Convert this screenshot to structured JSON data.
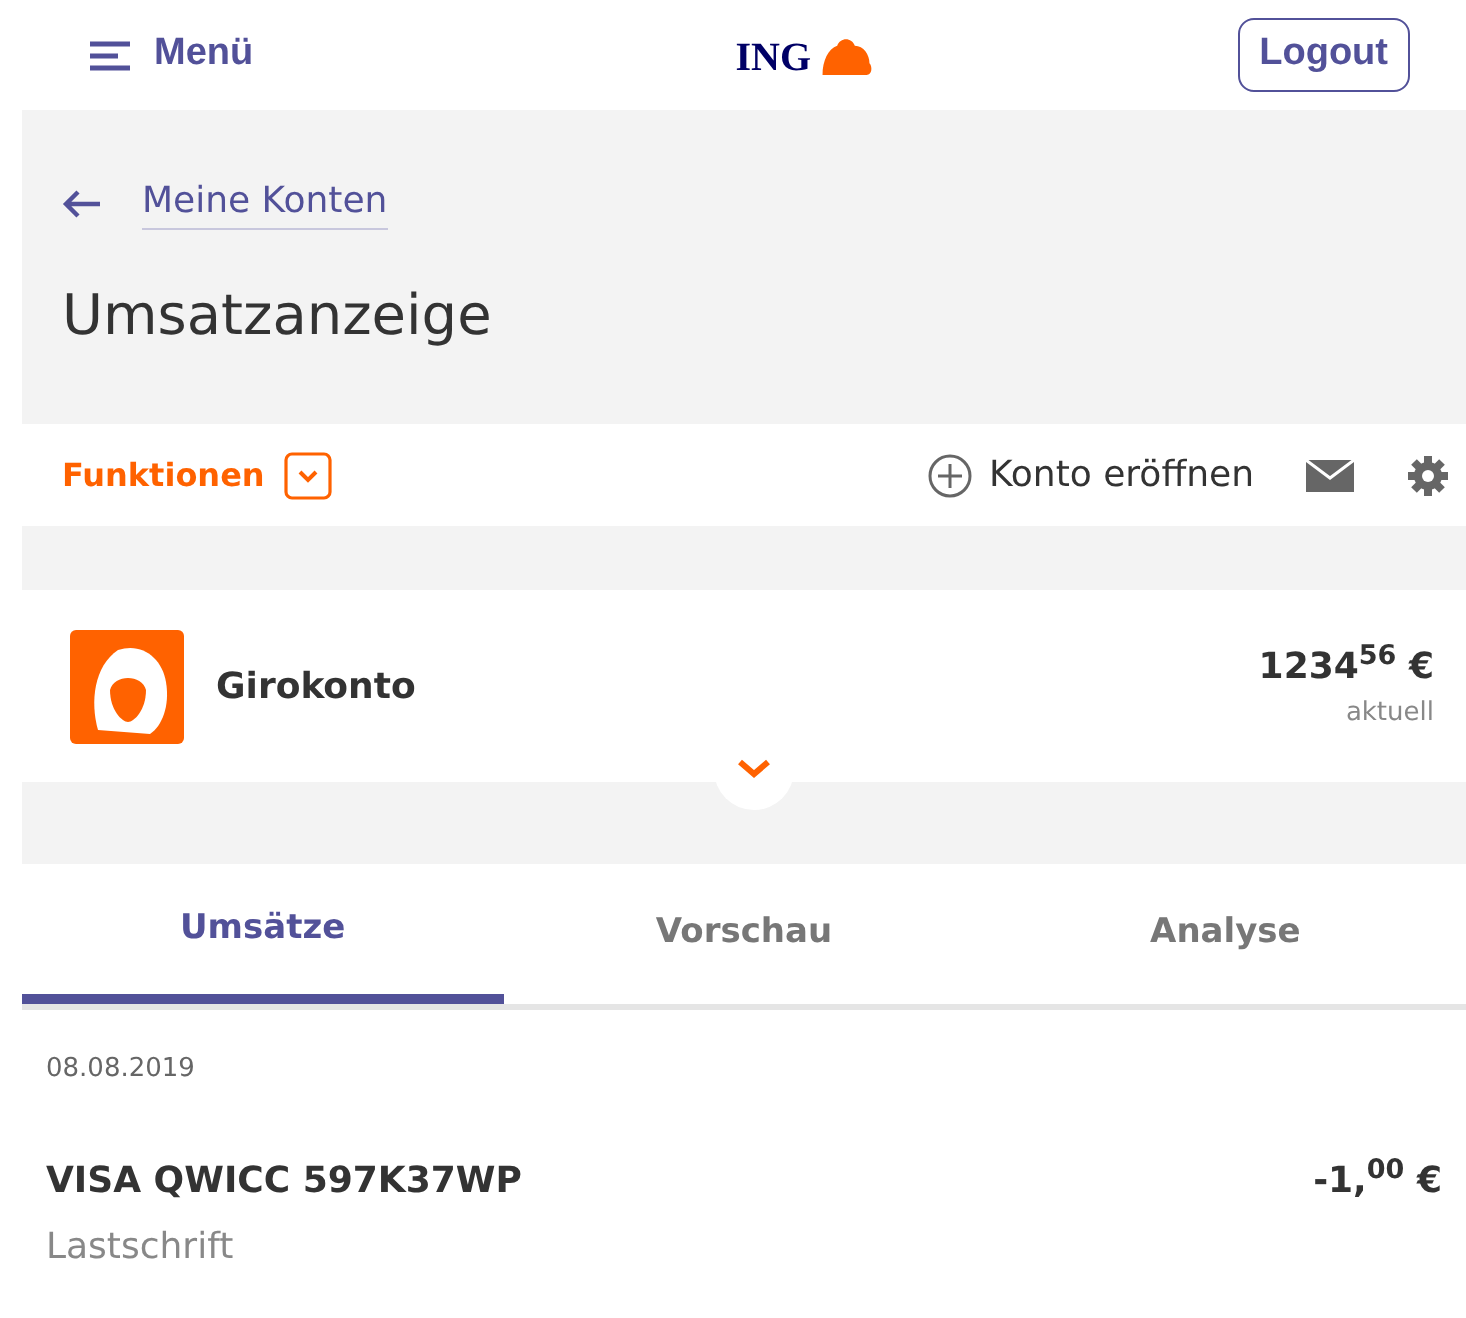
{
  "header": {
    "menu": "Menü",
    "logo": "ING",
    "logout": "Logout"
  },
  "breadcrumb": {
    "link": "Meine Konten"
  },
  "title": "Umsatzanzeige",
  "toolbar": {
    "functions": "Funktionen",
    "open_account": "Konto eröffnen"
  },
  "account": {
    "name": "Girokonto",
    "balance": "1234$^{56}$ €",
    "balance_label": "aktuell"
  },
  "tabs": [
    {
      "label": "Umsätze",
      "selected": true
    },
    {
      "label": "Vorschau",
      "selected": false
    },
    {
      "label": "Analyse",
      "selected": false
    }
  ],
  "transactions": [
    {
      "date": "08.08.2019",
      "title": "VISA QWICC 597K37WP",
      "amount": "-1,$^{00}$ €",
      "type": "Lastschrift"
    }
  ]
}
